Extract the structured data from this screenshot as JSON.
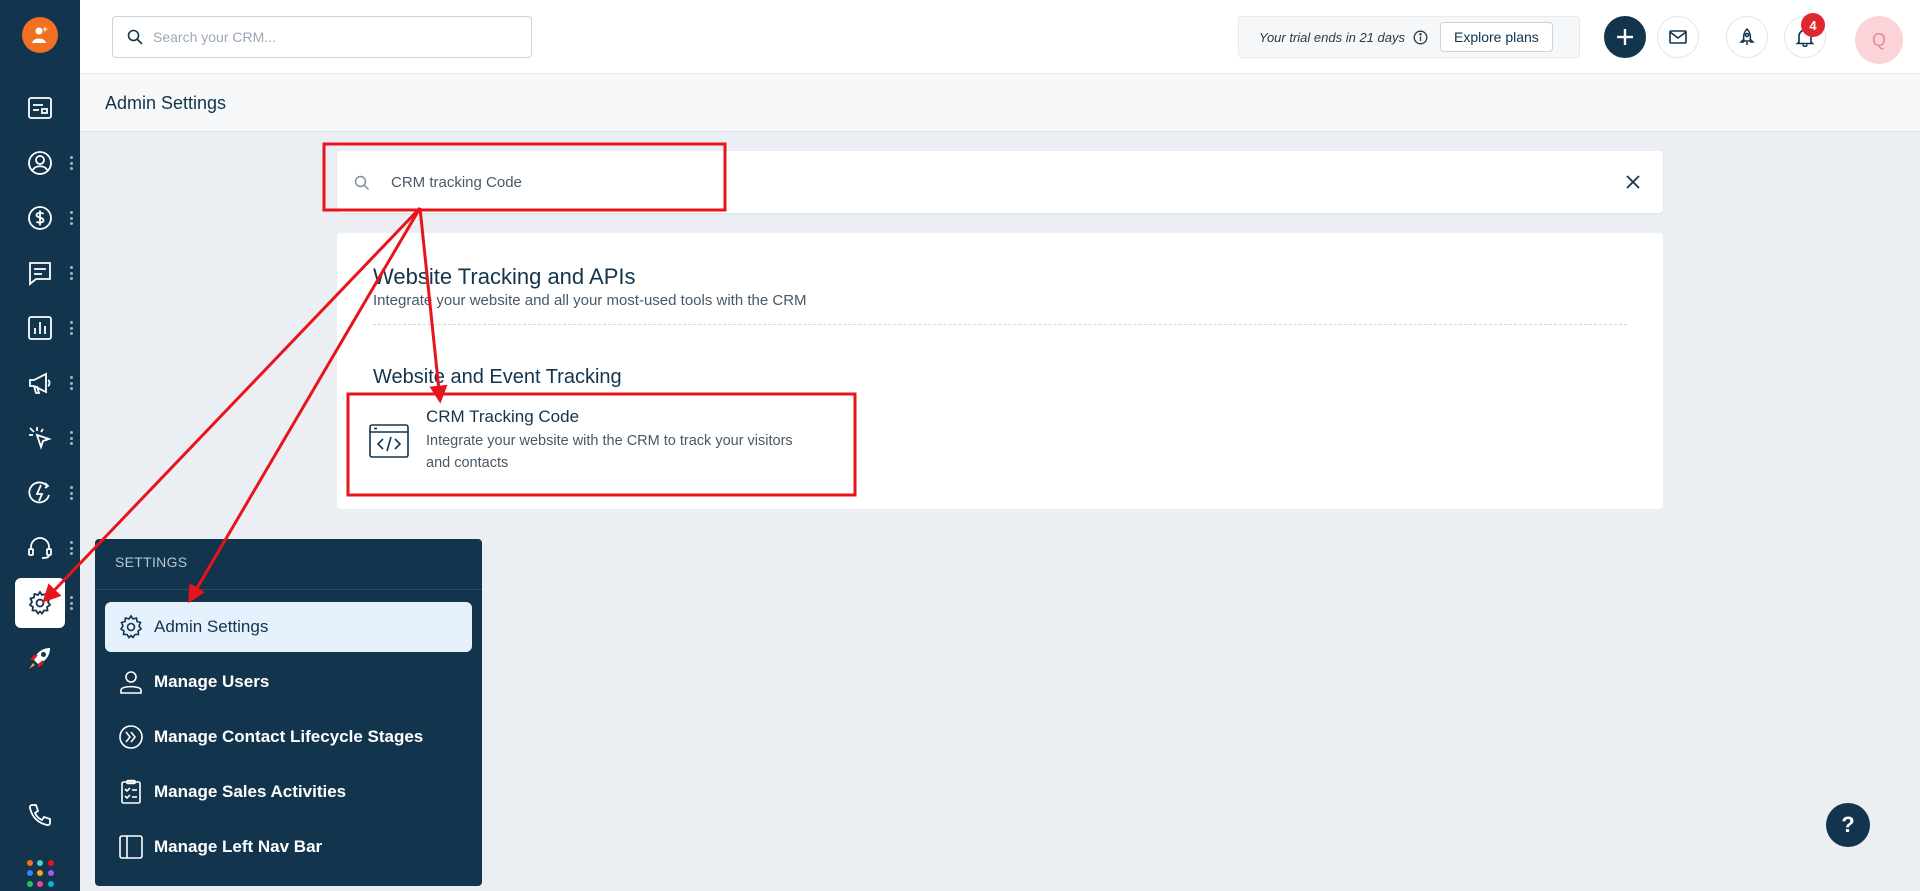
{
  "topbar": {
    "search_placeholder": "Search your CRM...",
    "trial_text": "Your trial ends in 21 days",
    "explore_label": "Explore plans",
    "notification_count": "4",
    "avatar_initial": "Q"
  },
  "page": {
    "title": "Admin Settings"
  },
  "settings_search": {
    "value": "CRM tracking Code"
  },
  "results": {
    "heading": "Website Tracking and APIs",
    "subheading": "Integrate your website and all your most-used tools with the CRM",
    "group": "Website and Event Tracking",
    "item": {
      "title": "CRM Tracking Code",
      "description": "Integrate your website with the CRM to track your visitors and contacts"
    }
  },
  "settings_menu": {
    "title": "SETTINGS",
    "items": [
      {
        "label": "Admin Settings",
        "icon": "gear-icon"
      },
      {
        "label": "Manage Users",
        "icon": "user-icon"
      },
      {
        "label": "Manage Contact Lifecycle Stages",
        "icon": "lifecycle-icon"
      },
      {
        "label": "Manage Sales Activities",
        "icon": "checklist-icon"
      },
      {
        "label": "Manage Left Nav Bar",
        "icon": "sidebar-layout-icon"
      }
    ]
  },
  "help": {
    "label": "?"
  },
  "colors": {
    "nav_bg": "#12344d",
    "accent": "#f36f21",
    "annotation": "#e8141b",
    "badge": "#e0262f"
  }
}
